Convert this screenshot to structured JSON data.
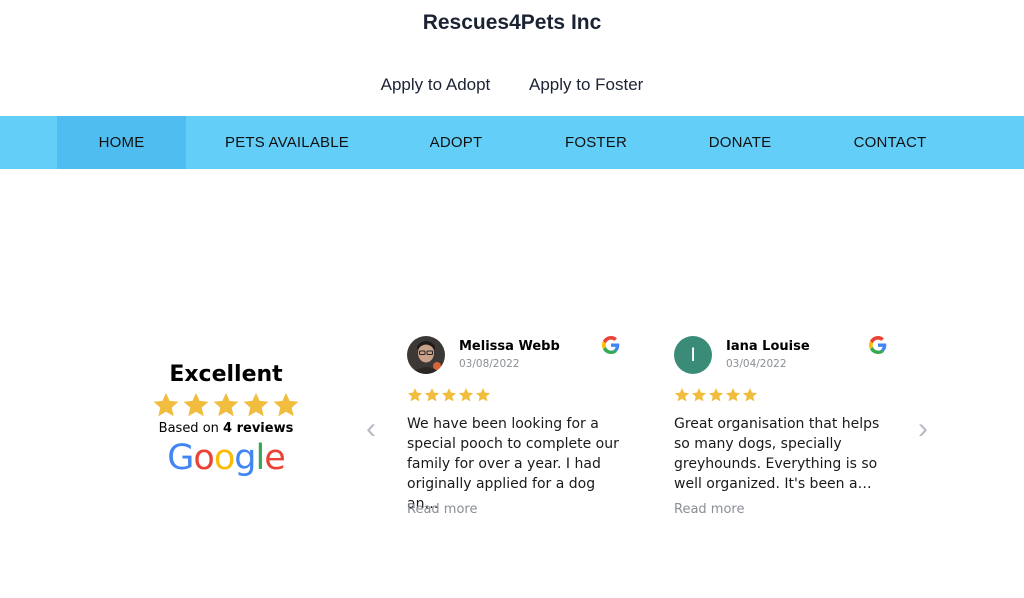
{
  "site": {
    "title": "Rescues4Pets Inc"
  },
  "apply_links": [
    {
      "label": "Apply to Adopt"
    },
    {
      "label": "Apply to Foster"
    }
  ],
  "nav": {
    "items": [
      {
        "label": "HOME",
        "active": true
      },
      {
        "label": "PETS AVAILABLE"
      },
      {
        "label": "ADOPT"
      },
      {
        "label": "FOSTER"
      },
      {
        "label": "DONATE"
      },
      {
        "label": "CONTACT"
      }
    ]
  },
  "reviews_widget": {
    "summary": {
      "rating_label": "Excellent",
      "stars": 5,
      "based_on_prefix": "Based on",
      "review_count_text": "4 reviews",
      "logo_letters": [
        "G",
        "o",
        "o",
        "g",
        "l",
        "e"
      ]
    },
    "reviews": [
      {
        "name": "Melissa Webb",
        "date": "03/08/2022",
        "stars": 5,
        "text": "We have been looking for a special pooch to complete our family for over a year. I had originally applied for a dog an…",
        "read_more": "Read more"
      },
      {
        "name": "Iana Louise",
        "avatar_letter": "I",
        "date": "03/04/2022",
        "stars": 5,
        "text": "Great organisation that helps so many dogs, specially greyhounds. Everything is so well organized. It's been a…",
        "read_more": "Read more"
      }
    ],
    "nav_prev_icon": "‹",
    "nav_next_icon": "›"
  },
  "colors": {
    "nav_bg": "#63cff9",
    "nav_active_bg": "#4fbdf0",
    "star": "#f1bd3e",
    "avatar_teal": "#3a8c78",
    "google_blue": "#4285F4",
    "google_red": "#EA4335",
    "google_yellow": "#FBBC05",
    "google_green": "#34A853"
  }
}
